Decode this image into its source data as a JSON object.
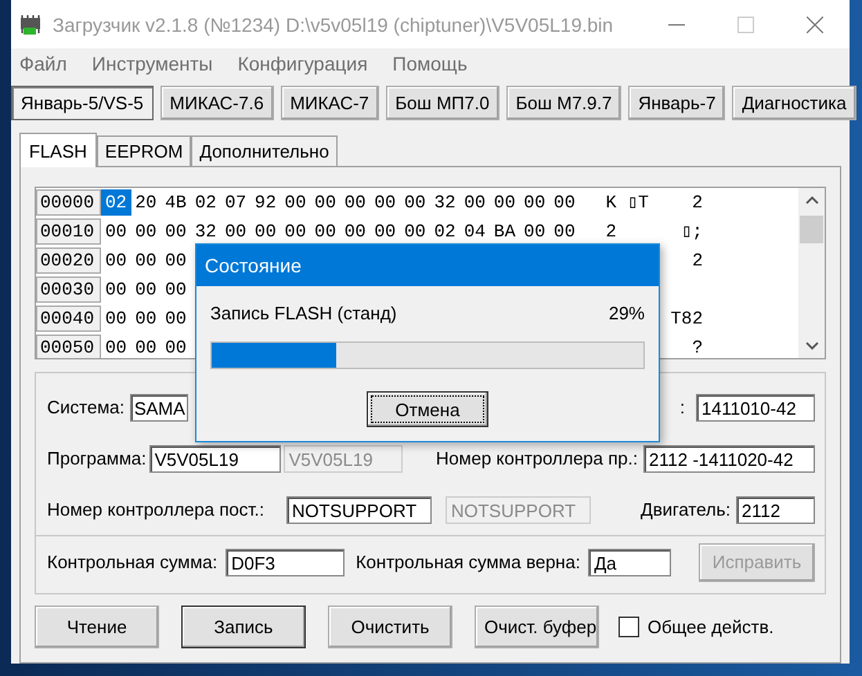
{
  "window": {
    "title": "Загрузчик v2.1.8 (№1234) D:\\v5v05l19 (chiptuner)\\V5V05L19.bin"
  },
  "menu": [
    "Файл",
    "Инструменты",
    "Конфигурация",
    "Помощь"
  ],
  "ecu_buttons": [
    {
      "label": "Январь-5/VS-5",
      "selected": true
    },
    {
      "label": "МИКАС-7.6",
      "selected": false
    },
    {
      "label": "МИКАС-7",
      "selected": false
    },
    {
      "label": "Бош МП7.0",
      "selected": false
    },
    {
      "label": "Бош М7.9.7",
      "selected": false
    },
    {
      "label": "Январь-7",
      "selected": false
    },
    {
      "label": "Диагностика",
      "selected": false
    }
  ],
  "tabs": [
    {
      "label": "FLASH",
      "selected": true
    },
    {
      "label": "EEPROM",
      "selected": false
    },
    {
      "label": "Дополнительно",
      "selected": false
    }
  ],
  "hex_rows": [
    {
      "address": "00000",
      "bytes": [
        {
          "value": "02",
          "selected": true
        },
        {
          "value": "20",
          "selected": false
        },
        {
          "value": "4B",
          "selected": false
        },
        {
          "value": "02",
          "selected": false
        },
        {
          "value": "07",
          "selected": false
        },
        {
          "value": "92",
          "selected": false
        },
        {
          "value": "00",
          "selected": false
        },
        {
          "value": "00",
          "selected": false
        },
        {
          "value": "00",
          "selected": false
        },
        {
          "value": "00",
          "selected": false
        },
        {
          "value": "00",
          "selected": false
        },
        {
          "value": "32",
          "selected": false
        },
        {
          "value": "00",
          "selected": false
        },
        {
          "value": "00",
          "selected": false
        },
        {
          "value": "00",
          "selected": false
        },
        {
          "value": "00",
          "selected": false
        }
      ],
      "ascii": "K ▯T    2"
    },
    {
      "address": "00010",
      "bytes": [
        {
          "value": "00",
          "selected": false
        },
        {
          "value": "00",
          "selected": false
        },
        {
          "value": "00",
          "selected": false
        },
        {
          "value": "32",
          "selected": false
        },
        {
          "value": "00",
          "selected": false
        },
        {
          "value": "00",
          "selected": false
        },
        {
          "value": "00",
          "selected": false
        },
        {
          "value": "00",
          "selected": false
        },
        {
          "value": "00",
          "selected": false
        },
        {
          "value": "00",
          "selected": false
        },
        {
          "value": "00",
          "selected": false
        },
        {
          "value": "02",
          "selected": false
        },
        {
          "value": "04",
          "selected": false
        },
        {
          "value": "BA",
          "selected": false
        },
        {
          "value": "00",
          "selected": false
        },
        {
          "value": "00",
          "selected": false
        }
      ],
      "ascii": "2      ▯;"
    },
    {
      "address": "00020",
      "bytes": [
        {
          "value": "00",
          "selected": false
        },
        {
          "value": "00",
          "selected": false
        },
        {
          "value": "00",
          "selected": false
        }
      ],
      "ascii": "2"
    },
    {
      "address": "00030",
      "bytes": [
        {
          "value": "00",
          "selected": false
        },
        {
          "value": "00",
          "selected": false
        },
        {
          "value": "00",
          "selected": false
        }
      ]
    },
    {
      "address": "00040",
      "bytes": [
        {
          "value": "00",
          "selected": false
        },
        {
          "value": "00",
          "selected": false
        },
        {
          "value": "00",
          "selected": false
        }
      ],
      "ascii": "T82"
    },
    {
      "address": "00050",
      "bytes": [
        {
          "value": "00",
          "selected": false
        },
        {
          "value": "00",
          "selected": false
        },
        {
          "value": "00",
          "selected": false
        }
      ],
      "ascii": "?"
    }
  ],
  "fields": {
    "system": {
      "label": "Система:",
      "value": "SAMA"
    },
    "row_a_right": {
      "label": ":",
      "value": "1411010-42"
    },
    "program": {
      "label": "Программа:",
      "value": "V5V05L19",
      "disabled_value": "V5V05L19"
    },
    "controller_pr": {
      "label": "Номер контроллера пр.:",
      "value": "2112 -1411020-42"
    },
    "controller_post": {
      "label": "Номер контроллера пост.:",
      "value": "NOTSUPPORT",
      "disabled_value": "NOTSUPPORT"
    },
    "engine": {
      "label": "Двигатель:",
      "value": "2112"
    },
    "checksum": {
      "label": "Контрольная сумма:",
      "value": "D0F3"
    },
    "checksum_ok": {
      "label": "Контрольная сумма верна:",
      "value": "Да"
    },
    "fix_button": {
      "label": "Исправить",
      "disabled": true
    }
  },
  "actions": [
    {
      "label": "Чтение",
      "focused": false
    },
    {
      "label": "Запись",
      "focused": true
    },
    {
      "label": "Очистить",
      "focused": false
    },
    {
      "label": "Очист. буфер",
      "focused": false
    }
  ],
  "common_action": {
    "label": "Общее действ.",
    "checked": false
  },
  "dialog": {
    "title": "Состояние",
    "message": "Запись FLASH (станд)",
    "percent": "29%",
    "level": 0.29,
    "cancel": "Отмена"
  }
}
